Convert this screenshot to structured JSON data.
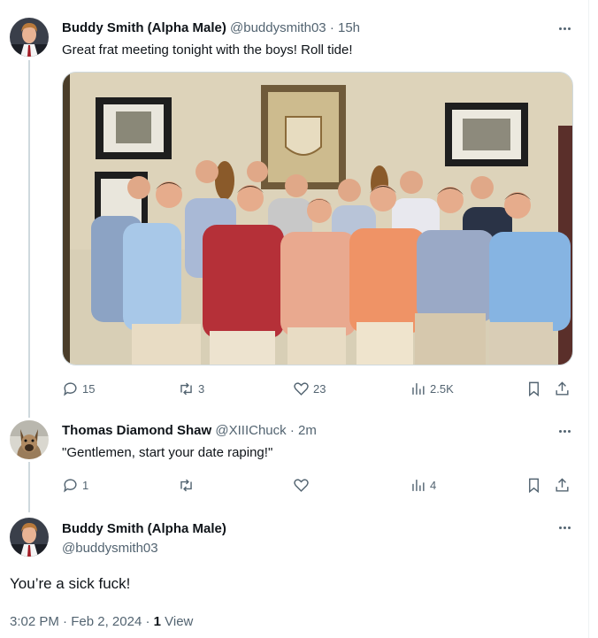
{
  "tweet1": {
    "name": "Buddy Smith (Alpha Male)",
    "handle": "@buddysmith03",
    "separator": "·",
    "time": "15h",
    "text": "Great frat meeting tonight with the boys! Roll tide!",
    "image_subject": "group-photo-of-young-men",
    "replies": "15",
    "retweets": "3",
    "likes": "23",
    "views": "2.5K"
  },
  "tweet2": {
    "name": "Thomas Diamond Shaw",
    "handle": "@XIIIChuck",
    "separator": "·",
    "time": "2m",
    "text": "\"Gentlemen, start your date raping!\"",
    "replies": "1",
    "retweets": "",
    "likes": "",
    "views": "4"
  },
  "tweet3": {
    "name": "Buddy Smith (Alpha Male)",
    "handle": "@buddysmith03",
    "text": "You’re a sick fuck!",
    "time": "3:02 PM",
    "sep1": "·",
    "date": "Feb 2, 2024",
    "sep2": "·",
    "view_count": "1",
    "view_label": "View"
  },
  "colors": {
    "text": "#0f1419",
    "secondary": "#536471",
    "thread_line": "#cfd9de"
  }
}
